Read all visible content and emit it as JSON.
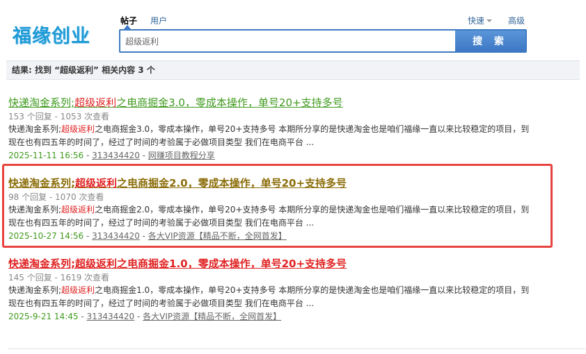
{
  "header": {
    "logo_text": "福缘创业",
    "tabs": [
      {
        "label": "帖子",
        "active": true
      },
      {
        "label": "用户",
        "active": false
      }
    ],
    "quick_label": "快速",
    "advanced_label": "高级"
  },
  "search": {
    "query": "超级返利",
    "button_label": "搜 索"
  },
  "results_summary": "结果: 找到 “超级返利” 相关内容 3 个",
  "results": [
    {
      "title_before": "快递淘金系列;",
      "title_highlight": "超级返利",
      "title_after": "之电商掘金3.0，零成本操作，单号20+支持多号",
      "stats": "153 个回复 - 1053 次查看",
      "desc_before": "快递淘金系列;",
      "desc_highlight": "超级返利",
      "desc_after": "之电商掘金3.0，零成本操作，单号20+支持多号 本期所分享的是快递淘金也是咱们福缘一直以来比较稳定的项目，到现在也有四五年的时间了，经过了时间的考验属于必做项目类型 我们在电商平台 ...",
      "date": "2025-11-11 16:56",
      "author": "313434420",
      "forum": "网赚项目教程分享"
    },
    {
      "title_before": "快递淘金系列;",
      "title_highlight": "超级返利",
      "title_after": "之电商掘金2.0，零成本操作，单号20+支持多号",
      "stats": "98 个回复 - 1070 次查看",
      "desc_before": "快递淘金系列;",
      "desc_highlight": "超级返利",
      "desc_after": "之电商掘金2.0，零成本操作，单号20+支持多号 本期所分享的是快递淘金也是咱们福缘一直以来比较稳定的项目，到现在也有四五年的时间了，经过了时间的考验属于必做项目类型 我们在电商平台 ...",
      "date": "2025-10-27 14:56",
      "author": "313434420",
      "forum": "各大VIP资源【精品不断，全网首发】"
    },
    {
      "title_before": "快递淘金系列;",
      "title_highlight": "超级返利",
      "title_after": "之电商掘金1.0，零成本操作，单号20+支持多号",
      "stats": "145 个回复 - 1619 次查看",
      "desc_before": "快递淘金系列;",
      "desc_highlight": "超级返利",
      "desc_after": "之电商掘金1.0，零成本操作，单号20+支持多号 本期所分享的是快递淘金也是咱们福缘一直以来比较稳定的项目，到现在也有四五年的时间了，经过了时间的考验属于必做项目类型 我们在电商平台 ...",
      "date": "2025-9-21 14:45",
      "author": "313434420",
      "forum": "各大VIP资源【精品不断，全网首发】"
    }
  ],
  "colors": {
    "accent_blue": "#3e7ac3",
    "highlight_red": "#e02222",
    "title_green": "#3f9a1f",
    "title_brown": "#8b6d09",
    "annotation_box": "#e8433e"
  }
}
